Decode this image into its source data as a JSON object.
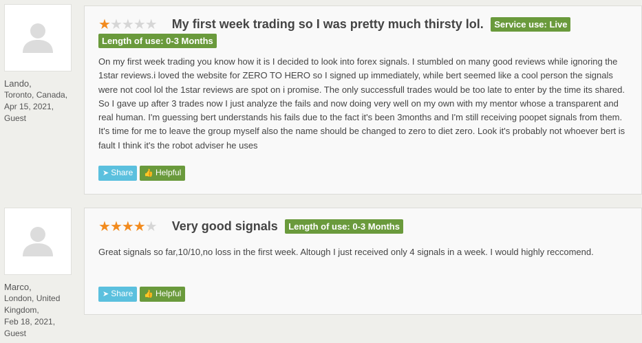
{
  "reviews": [
    {
      "author": {
        "name": "Lando,",
        "location": "Toronto, Canada,",
        "date": "Apr 15, 2021,",
        "role": "Guest"
      },
      "rating": 1,
      "rating_max": 5,
      "title": "My first week trading so I was pretty much thirsty lol.",
      "badges": [
        "Service use: Live",
        "Length of use: 0-3 Months"
      ],
      "body": "On my first week trading you know how it is I decided to look into forex signals. I stumbled on many good reviews while ignoring the 1star reviews.i loved the website for ZERO TO HERO so I signed up immediately, while bert seemed like a cool person the signals were not cool lol the 1star reviews are spot on i promise. The only successfull trades would be too late to enter by the time its shared. So I gave up after 3 trades now I just analyze the fails and now doing very well on my own with my mentor whose a transparent and real human. I'm guessing bert understands his fails due to the fact it's been 3months and I'm still receiving poopet signals from them. It's time for me to leave the group myself also the name should be changed to zero to diet zero. Look it's probably not whoever bert is fault I think it's the robot adviser he uses",
      "share_label": "Share",
      "helpful_label": "Helpful"
    },
    {
      "author": {
        "name": "Marco,",
        "location": "London, United Kingdom,",
        "date": "Feb 18, 2021,",
        "role": "Guest"
      },
      "rating": 4,
      "rating_max": 5,
      "title": "Very good signals",
      "badges": [
        "Length of use: 0-3 Months"
      ],
      "body": "Great signals so far,10/10,no loss in the first week. Altough I just received only 4 signals in a week. I would highly reccomend.",
      "share_label": "Share",
      "helpful_label": "Helpful"
    }
  ],
  "colors": {
    "star_on": "#f28b1e",
    "star_off": "#d6d6d6",
    "badge": "#6a9a3c",
    "share": "#5bc0de",
    "helpful": "#6a9a3c"
  },
  "icons": {
    "avatar": "user-silhouette-icon",
    "share": "share-icon",
    "helpful": "thumbs-up-icon"
  }
}
